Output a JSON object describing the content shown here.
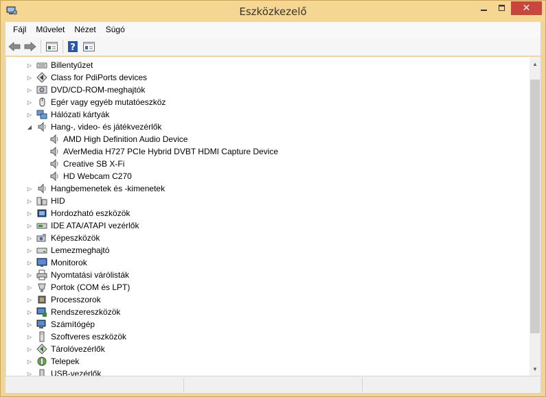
{
  "window": {
    "title": "Eszközkezelő",
    "close_glyph": "✕",
    "accent": "#f5d693"
  },
  "menu": [
    "Fájl",
    "Művelet",
    "Nézet",
    "Súgó"
  ],
  "toolbar_icons": [
    "back-arrow-icon",
    "forward-arrow-icon",
    "properties-icon",
    "help-icon",
    "update-driver-icon"
  ],
  "tree": [
    {
      "label": "Billentyűzet",
      "icon": "keyboard-icon",
      "level": 0,
      "expander": "collapsed"
    },
    {
      "label": "Class for PdiPorts devices",
      "icon": "diamond-arrow-icon",
      "level": 0,
      "expander": "collapsed"
    },
    {
      "label": "DVD/CD-ROM-meghajtók",
      "icon": "disc-drive-icon",
      "level": 0,
      "expander": "collapsed"
    },
    {
      "label": "Egér vagy egyéb mutatóeszköz",
      "icon": "mouse-icon",
      "level": 0,
      "expander": "collapsed"
    },
    {
      "label": "Hálózati kártyák",
      "icon": "network-icon",
      "level": 0,
      "expander": "collapsed"
    },
    {
      "label": "Hang-, video- és játékvezérlők",
      "icon": "speaker-icon",
      "level": 0,
      "expander": "expanded"
    },
    {
      "label": "AMD High Definition Audio Device",
      "icon": "speaker-icon",
      "level": 1,
      "expander": "none"
    },
    {
      "label": "AVerMedia H727 PCIe Hybrid DVBT HDMI Capture Device",
      "icon": "speaker-icon",
      "level": 1,
      "expander": "none"
    },
    {
      "label": "Creative SB X-Fi",
      "icon": "speaker-icon",
      "level": 1,
      "expander": "none"
    },
    {
      "label": "HD Webcam C270",
      "icon": "speaker-icon",
      "level": 1,
      "expander": "none"
    },
    {
      "label": "Hangbemenetek és -kimenetek",
      "icon": "speaker-icon",
      "level": 0,
      "expander": "collapsed"
    },
    {
      "label": "HID",
      "icon": "hid-icon",
      "level": 0,
      "expander": "collapsed"
    },
    {
      "label": "Hordozható eszközök",
      "icon": "portable-device-icon",
      "level": 0,
      "expander": "collapsed"
    },
    {
      "label": "IDE ATA/ATAPI vezérlők",
      "icon": "ide-controller-icon",
      "level": 0,
      "expander": "collapsed"
    },
    {
      "label": "Képeszközök",
      "icon": "camera-icon",
      "level": 0,
      "expander": "collapsed"
    },
    {
      "label": "Lemezmeghajtó",
      "icon": "disk-drive-icon",
      "level": 0,
      "expander": "collapsed"
    },
    {
      "label": "Monitorok",
      "icon": "monitor-icon",
      "level": 0,
      "expander": "collapsed"
    },
    {
      "label": "Nyomtatási várólisták",
      "icon": "printer-icon",
      "level": 0,
      "expander": "collapsed"
    },
    {
      "label": "Portok (COM és LPT)",
      "icon": "port-icon",
      "level": 0,
      "expander": "collapsed"
    },
    {
      "label": "Processzorok",
      "icon": "processor-icon",
      "level": 0,
      "expander": "collapsed"
    },
    {
      "label": "Rendszereszközök",
      "icon": "system-devices-icon",
      "level": 0,
      "expander": "collapsed"
    },
    {
      "label": "Számítógép",
      "icon": "computer-icon",
      "level": 0,
      "expander": "collapsed"
    },
    {
      "label": "Szoftveres eszközök",
      "icon": "software-device-icon",
      "level": 0,
      "expander": "collapsed"
    },
    {
      "label": "Tárolóvezérlők",
      "icon": "storage-controller-icon",
      "level": 0,
      "expander": "collapsed"
    },
    {
      "label": "Telepek",
      "icon": "battery-icon",
      "level": 0,
      "expander": "collapsed"
    },
    {
      "label": "USB-vezérlők",
      "icon": "usb-icon",
      "level": 0,
      "expander": "collapsed"
    }
  ],
  "scrollbar": {
    "up_glyph": "▲",
    "down_glyph": "▼"
  }
}
